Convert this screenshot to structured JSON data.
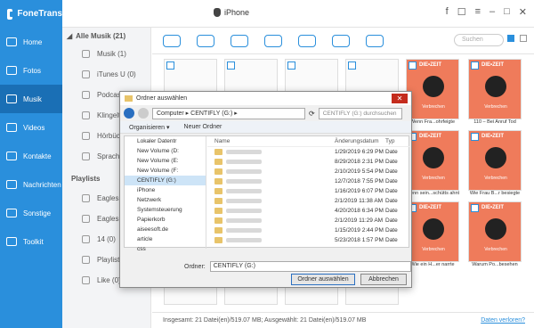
{
  "app": {
    "name": "FoneTrans",
    "device": "iPhone"
  },
  "sidebar": [
    {
      "label": "Home"
    },
    {
      "label": "Fotos"
    },
    {
      "label": "Musik"
    },
    {
      "label": "Videos"
    },
    {
      "label": "Kontakte"
    },
    {
      "label": "Nachrichten"
    },
    {
      "label": "Sonstige"
    },
    {
      "label": "Toolkit"
    }
  ],
  "sub": {
    "header": "Alle Musik (21)",
    "items": [
      "Musik (1)",
      "iTunes U (0)",
      "Podcasts",
      "Klingeltö",
      "Hörbüche",
      "Sprachm"
    ],
    "playlists_label": "Playlists",
    "playlists": [
      "Eagles -",
      "Eagles -",
      "14 (0)",
      "Playlist 2",
      "Like (0)"
    ]
  },
  "search_placeholder": "Suchen",
  "grid": {
    "red_label": "DIE•ZEIT",
    "red_sub": "Verbrechen",
    "captions": [
      "Wenn Fra...ohrfeigte",
      "110 – Bei Anruf Tod",
      "Wenn sein...schütts ahnt",
      "Wie Frau B...r besiegte",
      "Wie ein H...er narrte",
      "Warum Po...besehen"
    ]
  },
  "status": {
    "text": "Insgesamt: 21 Datei(en)/519.07 MB; Ausgewählt: 21 Datei(en)/519.07 MB",
    "lost": "Daten verloren?"
  },
  "dialog": {
    "title": "Ordner auswählen",
    "path": "Computer ▸ CENTIFLY (G:) ▸",
    "search": "CENTIFLY (G:) durchsuchen",
    "organize": "Organisieren ▾",
    "new_folder": "Neuer Ordner",
    "tree": [
      "Lokaler Datentr",
      "New Volume (D:",
      "New Volume (E:",
      "New Volume (F:",
      "CENTIFLY (G:)",
      "iPhone",
      "Netzwerk",
      "Systemsteuerung",
      "Papierkorb",
      "aiseesoft.de",
      "article",
      "css"
    ],
    "headers": {
      "name": "Name",
      "date": "Änderungsdatum",
      "type": "Typ"
    },
    "dates": [
      "1/29/2019 6:29 PM",
      "8/29/2018 2:31 PM",
      "2/10/2019 5:54 PM",
      "12/7/2018 7:55 PM",
      "1/16/2019 6:07 PM",
      "2/1/2019 11:38 AM",
      "4/20/2018 6:34 PM",
      "2/1/2019 11:29 AM",
      "1/15/2019 2:44 PM",
      "5/23/2018 1:57 PM"
    ],
    "type": "Date",
    "folder_label": "Ordner:",
    "folder_value": "CENTIFLY (G:)",
    "ok": "Ordner auswählen",
    "cancel": "Abbrechen"
  }
}
